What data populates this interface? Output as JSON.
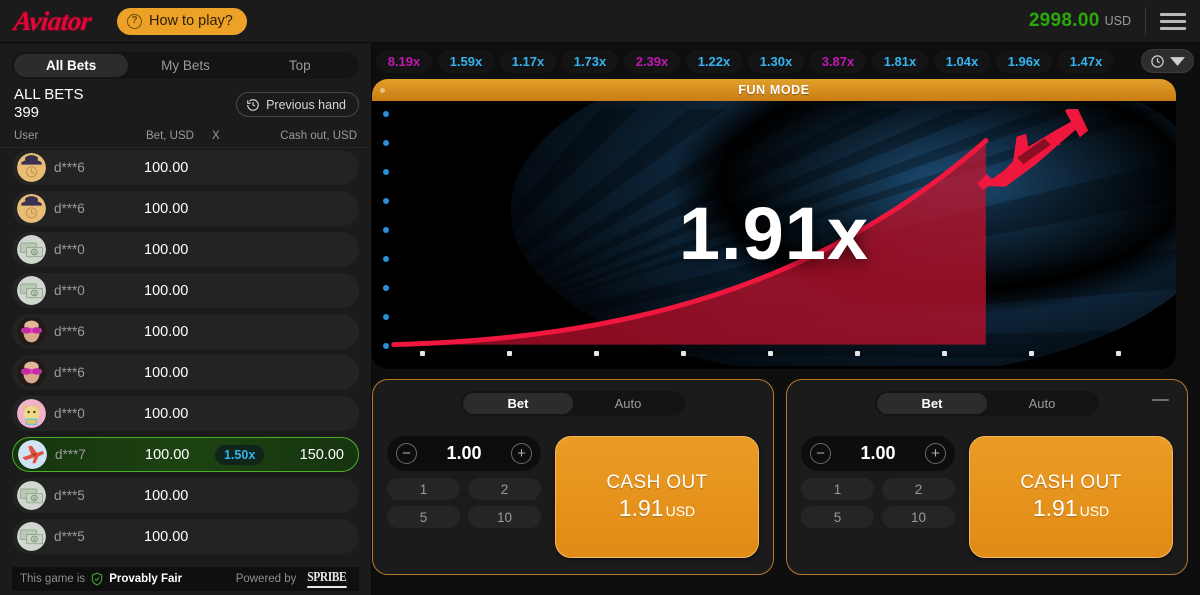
{
  "header": {
    "logo_text": "Aviator",
    "how_to_play": "How to play?",
    "balance": "2998.00",
    "currency": "USD",
    "menu_icon": "hamburger-menu-icon",
    "help_icon": "question-mark-icon"
  },
  "sidebar": {
    "tabs": [
      {
        "label": "All Bets",
        "active": true
      },
      {
        "label": "My Bets",
        "active": false
      },
      {
        "label": "Top",
        "active": false
      }
    ],
    "section_title": "ALL BETS",
    "bet_count": "399",
    "previous_hand": "Previous hand",
    "previous_hand_icon": "history-clock-icon",
    "columns": {
      "user": "User",
      "bet": "Bet, USD",
      "x": "X",
      "cashout": "Cash out, USD"
    },
    "bets": [
      {
        "user": "d***6",
        "bet": "100.00",
        "mult": "",
        "cashout": "",
        "win": false,
        "avatar": "avatar-hat-clock"
      },
      {
        "user": "d***6",
        "bet": "100.00",
        "mult": "",
        "cashout": "",
        "win": false,
        "avatar": "avatar-hat-clock"
      },
      {
        "user": "d***0",
        "bet": "100.00",
        "mult": "",
        "cashout": "",
        "win": false,
        "avatar": "avatar-money"
      },
      {
        "user": "d***0",
        "bet": "100.00",
        "mult": "",
        "cashout": "",
        "win": false,
        "avatar": "avatar-money"
      },
      {
        "user": "d***6",
        "bet": "100.00",
        "mult": "",
        "cashout": "",
        "win": false,
        "avatar": "avatar-sunglasses"
      },
      {
        "user": "d***6",
        "bet": "100.00",
        "mult": "",
        "cashout": "",
        "win": false,
        "avatar": "avatar-sunglasses"
      },
      {
        "user": "d***0",
        "bet": "100.00",
        "mult": "",
        "cashout": "",
        "win": false,
        "avatar": "avatar-cat"
      },
      {
        "user": "d***7",
        "bet": "100.00",
        "mult": "1.50x",
        "cashout": "150.00",
        "win": true,
        "avatar": "avatar-plane"
      },
      {
        "user": "d***5",
        "bet": "100.00",
        "mult": "",
        "cashout": "",
        "win": false,
        "avatar": "avatar-money"
      },
      {
        "user": "d***5",
        "bet": "100.00",
        "mult": "",
        "cashout": "",
        "win": false,
        "avatar": "avatar-money"
      }
    ],
    "footer": {
      "prefix": "This game is",
      "fair_label": "Provably Fair",
      "fair_icon": "shield-check-icon",
      "powered_by": "Powered by",
      "brand": "SPRIBE"
    }
  },
  "history": {
    "chips": [
      {
        "value": "8.19x",
        "color": "purple"
      },
      {
        "value": "1.59x",
        "color": "blue"
      },
      {
        "value": "1.17x",
        "color": "blue"
      },
      {
        "value": "1.73x",
        "color": "blue"
      },
      {
        "value": "2.39x",
        "color": "purple"
      },
      {
        "value": "1.22x",
        "color": "blue"
      },
      {
        "value": "1.30x",
        "color": "blue"
      },
      {
        "value": "3.87x",
        "color": "purple"
      },
      {
        "value": "1.81x",
        "color": "blue"
      },
      {
        "value": "1.04x",
        "color": "blue"
      },
      {
        "value": "1.96x",
        "color": "blue"
      },
      {
        "value": "1.47x",
        "color": "blue"
      }
    ],
    "toggle_icon": "history-clock-icon",
    "chevron_icon": "chevron-down-icon"
  },
  "game": {
    "banner": "FUN MODE",
    "multiplier": "1.91x",
    "plane_icon": "red-plane-icon"
  },
  "panels": [
    {
      "tabs": [
        {
          "label": "Bet",
          "active": true
        },
        {
          "label": "Auto",
          "active": false
        }
      ],
      "stake": "1.00",
      "decrease_icon": "minus-circle-icon",
      "increase_icon": "plus-circle-icon",
      "quick_amounts": [
        "1",
        "2",
        "5",
        "10"
      ],
      "cashout_label": "CASH OUT",
      "cashout_amount": "1.91",
      "cashout_currency": "USD",
      "has_collapse": false
    },
    {
      "tabs": [
        {
          "label": "Bet",
          "active": true
        },
        {
          "label": "Auto",
          "active": false
        }
      ],
      "stake": "1.00",
      "decrease_icon": "minus-circle-icon",
      "increase_icon": "plus-circle-icon",
      "quick_amounts": [
        "1",
        "2",
        "5",
        "10"
      ],
      "cashout_label": "CASH OUT",
      "cashout_amount": "1.91",
      "cashout_currency": "USD",
      "has_collapse": true,
      "collapse_icon": "minus-icon"
    }
  ],
  "colors": {
    "brand_red": "#e50539",
    "accent_orange": "#eda227",
    "balance_green": "#28a909",
    "chip_blue": "#34b3f1",
    "chip_purple": "#c017b4",
    "win_green": "#4caf27"
  }
}
